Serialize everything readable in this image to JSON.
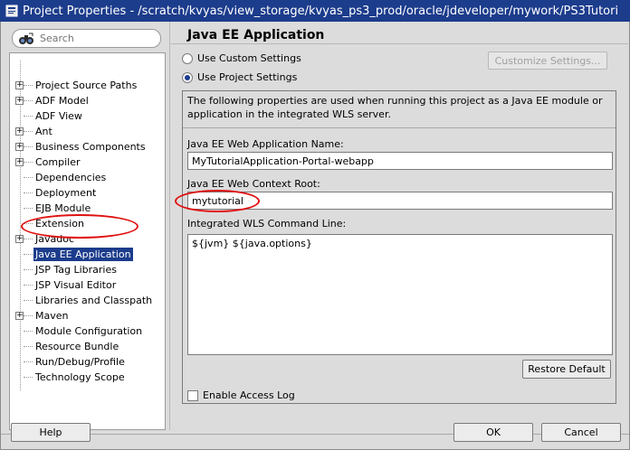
{
  "window": {
    "title": "Project Properties - /scratch/kvyas/view_storage/kvyas_ps3_prod/oracle/jdeveloper/mywork/PS3Tutori"
  },
  "search": {
    "placeholder": "Search"
  },
  "tree": {
    "items": [
      {
        "label": "Project Source Paths",
        "expandable": true,
        "selected": false
      },
      {
        "label": "ADF Model",
        "expandable": true,
        "selected": false
      },
      {
        "label": "ADF View",
        "expandable": false,
        "selected": false
      },
      {
        "label": "Ant",
        "expandable": true,
        "selected": false
      },
      {
        "label": "Business Components",
        "expandable": true,
        "selected": false
      },
      {
        "label": "Compiler",
        "expandable": true,
        "selected": false
      },
      {
        "label": "Dependencies",
        "expandable": false,
        "selected": false
      },
      {
        "label": "Deployment",
        "expandable": false,
        "selected": false
      },
      {
        "label": "EJB Module",
        "expandable": false,
        "selected": false
      },
      {
        "label": "Extension",
        "expandable": false,
        "selected": false
      },
      {
        "label": "Javadoc",
        "expandable": true,
        "selected": false
      },
      {
        "label": "Java EE Application",
        "expandable": false,
        "selected": true
      },
      {
        "label": "JSP Tag Libraries",
        "expandable": false,
        "selected": false
      },
      {
        "label": "JSP Visual Editor",
        "expandable": false,
        "selected": false
      },
      {
        "label": "Libraries and Classpath",
        "expandable": false,
        "selected": false
      },
      {
        "label": "Maven",
        "expandable": true,
        "selected": false
      },
      {
        "label": "Module Configuration",
        "expandable": false,
        "selected": false
      },
      {
        "label": "Resource Bundle",
        "expandable": false,
        "selected": false
      },
      {
        "label": "Run/Debug/Profile",
        "expandable": false,
        "selected": false
      },
      {
        "label": "Technology Scope",
        "expandable": false,
        "selected": false
      }
    ]
  },
  "page": {
    "title": "Java EE Application",
    "radio_custom": "Use Custom Settings",
    "radio_project": "Use Project Settings",
    "selected_radio": "project",
    "customize_button": "Customize Settings...",
    "description": "The following properties are used when running this project as a Java EE module or application in the integrated WLS server.",
    "web_app_name_label": "Java EE Web Application Name:",
    "web_app_name_value": "MyTutorialApplication-Portal-webapp",
    "context_root_label": "Java EE Web Context Root:",
    "context_root_value": "mytutorial",
    "command_line_label": "Integrated WLS Command Line:",
    "command_line_value": "${jvm} ${java.options}",
    "restore_button": "Restore Default",
    "access_log_label": "Enable Access Log",
    "access_log_checked": false
  },
  "buttons": {
    "help": "Help",
    "ok": "OK",
    "cancel": "Cancel"
  },
  "colors": {
    "titlebar": "#1c3c8c",
    "selection": "#1c3c8c",
    "annotation": "#e01010"
  }
}
